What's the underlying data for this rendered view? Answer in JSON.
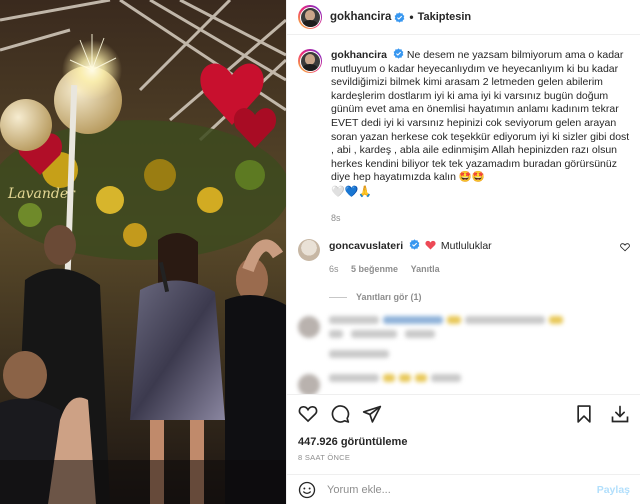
{
  "header": {
    "username": "gokhancira",
    "separator": "•",
    "follow_label": "Takiptesin"
  },
  "caption": {
    "username": "gokhancira",
    "text": "Ne desem ne yazsam bilmiyorum ama o kadar mutluyum o kadar heyecanlıydım ve heyecanlıyım ki bu kadar sevildiğimizi bilmek kimi arasam 2 letmeden gelen abilerim kardeşlerim dostlarım iyi ki ama iyi ki varsınız bugün doğum günüm evet ama en önemlisi hayatımın anlamı kadınım tekrar EVET dedi iyi ki varsınız hepinizi cok seviyorum gelen arayan soran yazan herkese cok teşekkür ediyorum iyi ki sizler gibi dost , abi , kardeş , abla aile edinmişim Allah hepinizden razı olsun herkes kendini biliyor tek tek yazamadım buradan görürsünüz diye hep hayatımızda kalın 🤩🤩",
    "emojis": "🤍💙🙏",
    "time": "8s"
  },
  "comment": {
    "username": "goncavuslateri",
    "text": "Mutluluklar",
    "time": "6s",
    "likes": "5 beğenme",
    "reply_label": "Yanıtla",
    "view_replies": "Yanıtları gör (1)"
  },
  "stats": {
    "views": "447.926 görüntüleme",
    "posted": "8 SAAT ÖNCE"
  },
  "add_comment": {
    "placeholder": "Yorum ekle...",
    "post_label": "Paylaş"
  },
  "icons": [
    "heart-icon",
    "comment-icon",
    "share-icon",
    "bookmark-icon",
    "download-icon",
    "smile-icon"
  ],
  "colors": {
    "verified": "#3897f0",
    "heart_red": "#ed4956",
    "post_disabled": "#b2dffc",
    "meta_gray": "#8e8e8e"
  }
}
